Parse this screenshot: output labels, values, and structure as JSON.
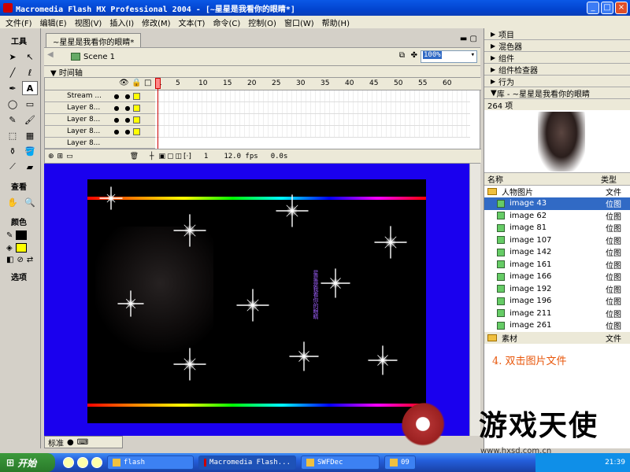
{
  "window": {
    "title": "Macromedia Flash MX Professional 2004 - [~星星是我看你的眼睛*]",
    "buttons": [
      "_",
      "□",
      "×"
    ]
  },
  "menu": [
    "文件(F)",
    "编辑(E)",
    "视图(V)",
    "插入(I)",
    "修改(M)",
    "文本(T)",
    "命令(C)",
    "控制(O)",
    "窗口(W)",
    "帮助(H)"
  ],
  "tools": {
    "header": "工具",
    "view_label": "查看",
    "color_label": "颜色",
    "options_label": "选项",
    "stroke_color": "#000000",
    "fill_color": "#ffff00"
  },
  "document": {
    "tab": "~星星是我看你的眼睛*",
    "scene": "Scene 1",
    "zoom": "100%"
  },
  "timeline": {
    "header": "时间轴",
    "frame_numbers": [
      "1",
      "5",
      "10",
      "15",
      "20",
      "25",
      "30",
      "35",
      "40",
      "45",
      "50",
      "55",
      "60"
    ],
    "layers": [
      "Stream ...",
      "Layer 8...",
      "Layer 8...",
      "Layer 8...",
      "Layer 8..."
    ],
    "current_frame": "1",
    "fps": "12.0 fps",
    "time": "0.0s"
  },
  "stage": {
    "background": "#1a00ee",
    "vertical_text": "星星是我看你的眼睛"
  },
  "status": {
    "label": "标准"
  },
  "panels": {
    "collapsed": [
      "项目",
      "混色器",
      "组件",
      "组件检查器",
      "行为"
    ],
    "library_title": "库 - ~星星是我看你的眼睛",
    "item_count": "264 项",
    "col_name": "名称",
    "col_type": "类型",
    "folder1": "人物图片",
    "folder1_kind": "文件",
    "items": [
      {
        "name": "image 43",
        "kind": "位图"
      },
      {
        "name": "image 62",
        "kind": "位图"
      },
      {
        "name": "image 81",
        "kind": "位图"
      },
      {
        "name": "image 107",
        "kind": "位图"
      },
      {
        "name": "image 142",
        "kind": "位图"
      },
      {
        "name": "image 161",
        "kind": "位图"
      },
      {
        "name": "image 166",
        "kind": "位图"
      },
      {
        "name": "image 192",
        "kind": "位图"
      },
      {
        "name": "image 196",
        "kind": "位图"
      },
      {
        "name": "image 211",
        "kind": "位图"
      },
      {
        "name": "image 261",
        "kind": "位图"
      }
    ],
    "folder2": "素材",
    "folder2_kind": "文件",
    "hint": "4. 双击图片文件"
  },
  "watermark": {
    "text": "游戏天使",
    "sub": "www.hxsd.com.cn"
  },
  "taskbar": {
    "start": "开始",
    "tasks": [
      "flash",
      "Macromedia Flash...",
      "SWFDec",
      "09"
    ],
    "clock": "21:39"
  }
}
